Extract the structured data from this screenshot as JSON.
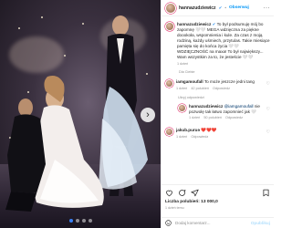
{
  "post": {
    "username": "hannazudziewicz",
    "follow_label": "Obserwuj",
    "caption_username": "hannazudziewicz",
    "caption_text": "To był podsumuję mój bo zapomnę 🤍🤍 MEGA wdzięczna za piękne doookoła, wspomnienia i kule. Za czas z moją rodziną, każdy uśmiech, przytulas. Takie miesiące pamięta się do końca życia 🤍🤍 WDZIĘCZNOŚĆ na maxa! To był największy... Wam wszystkim za to, że jesteście 🤍🤍",
    "caption_time": "1 dzień",
    "translate_label": "Zobacz tłumaczenie",
    "caption_author_extra": "Dla Ciebie"
  },
  "comments": [
    {
      "username": "iamgamoufall",
      "text": "To może jeszcze jedni tang",
      "time": "1 dzień",
      "likes": "42 polubień",
      "reply_label": "Odpowiedz",
      "replies_label": "Ukryj odpowiedzi",
      "replies": [
        {
          "username": "hannazudziewicz",
          "mention": "@iamgamoufall",
          "text": "nie pozwolę tak łatwo zapomnieć jak",
          "emoji": "🤍",
          "time": "1 dzień",
          "likes": "50 polubień",
          "reply_label": "Odpowiedz"
        }
      ]
    },
    {
      "username": "jakub.puruə",
      "text": "❤️❤️❤️",
      "time": "1 dzień",
      "likes": "",
      "reply_label": "Odpowiedz"
    }
  ],
  "footer": {
    "likes_label": "Liczba polubień: 13 000,0",
    "date": "1 dzień temu",
    "comment_placeholder": "Dodaj komentarz...",
    "publish_label": "Opublikuj"
  },
  "photo": {
    "slides_total": 4,
    "slide_active": 1
  },
  "icons": {
    "more": "more-icon",
    "heart": "heart-icon",
    "comment": "comment-icon",
    "share": "share-icon",
    "save": "save-icon",
    "emoji": "emoji-icon",
    "next": "chevron-right-icon"
  },
  "colors": {
    "accent": "#0095f6",
    "verified": "#3897f0",
    "like_red": "#ed4956"
  }
}
